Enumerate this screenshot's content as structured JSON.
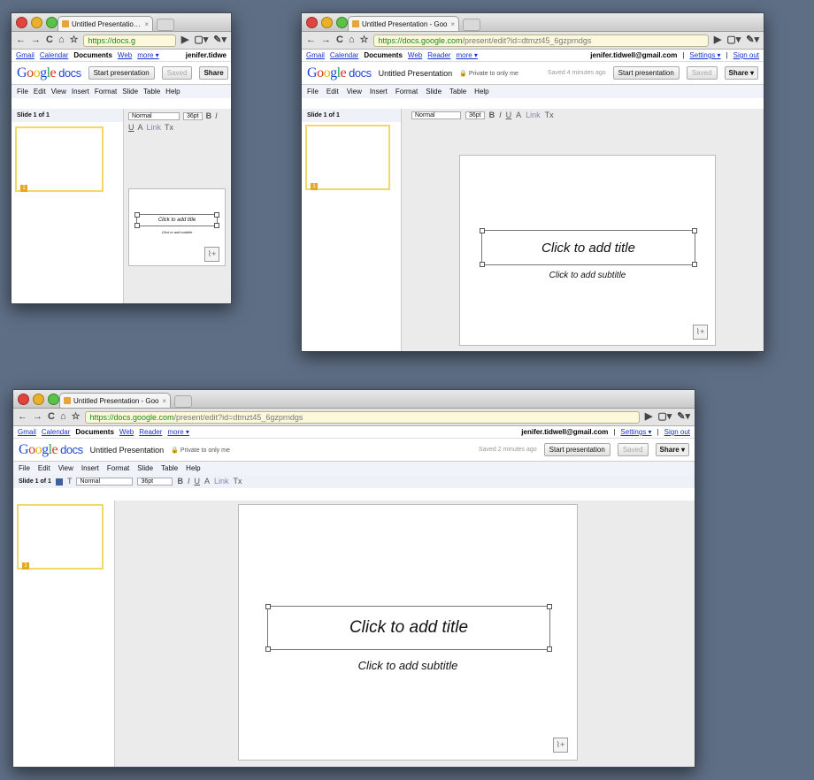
{
  "common": {
    "tab_title": "Untitled Presentation - Goo",
    "tab_close": "×",
    "nav_back": "←",
    "nav_forward": "→",
    "nav_reload": "C",
    "nav_home": "⌂",
    "nav_star": "☆",
    "nav_go": "▶",
    "nav_page": "▢▾",
    "nav_wrench": "✎▾",
    "gbar": {
      "gmail": "Gmail",
      "calendar": "Calendar",
      "documents": "Documents",
      "web": "Web",
      "reader": "Reader",
      "more": "more ▾",
      "email": "jenifer.tidwell@gmail.com",
      "settings": "Settings ▾",
      "signout": "Sign out",
      "sep": "|"
    },
    "logo": {
      "G": "G",
      "o1": "o",
      "o2": "o",
      "g": "g",
      "l": "l",
      "e": "e",
      "docs": "docs"
    },
    "doc_name": "Untitled Presentation",
    "private": "🔒 Private to only me",
    "start_presentation": "Start presentation",
    "saved": "Saved",
    "share": "Share",
    "share_caret": "▾",
    "menu": [
      "File",
      "Edit",
      "View",
      "Insert",
      "Format",
      "Slide",
      "Table",
      "Help"
    ],
    "slide_count": "Slide 1 of 1",
    "style_select": "Normal",
    "size_select": "36pt",
    "toolbar_glyphs": {
      "bold": "B",
      "italic": "I",
      "underline": "U",
      "color": "A",
      "link": "Link",
      "clear": "Tx",
      "text": "T"
    },
    "canvas_title": "Click to add title",
    "canvas_subtitle": "Click to add subtitle",
    "thumb_number": "1",
    "notes_icon": "⌇+"
  },
  "windows": {
    "small": {
      "url_secure": "https://docs.g",
      "url_rest": "",
      "email_short": "jenifer.tidwe",
      "share_short": "Share"
    },
    "medium": {
      "url_secure": "https://docs.google.com",
      "url_rest": "/present/edit?id=dtmzt45_6gzprndgs",
      "saved_note": "Saved 4 minutes ago"
    },
    "large": {
      "url_secure": "https://docs.google.com",
      "url_rest": "/present/edit?id=dtmzt45_6gzprndgs",
      "saved_note": "Saved 2 minutes ago"
    }
  }
}
